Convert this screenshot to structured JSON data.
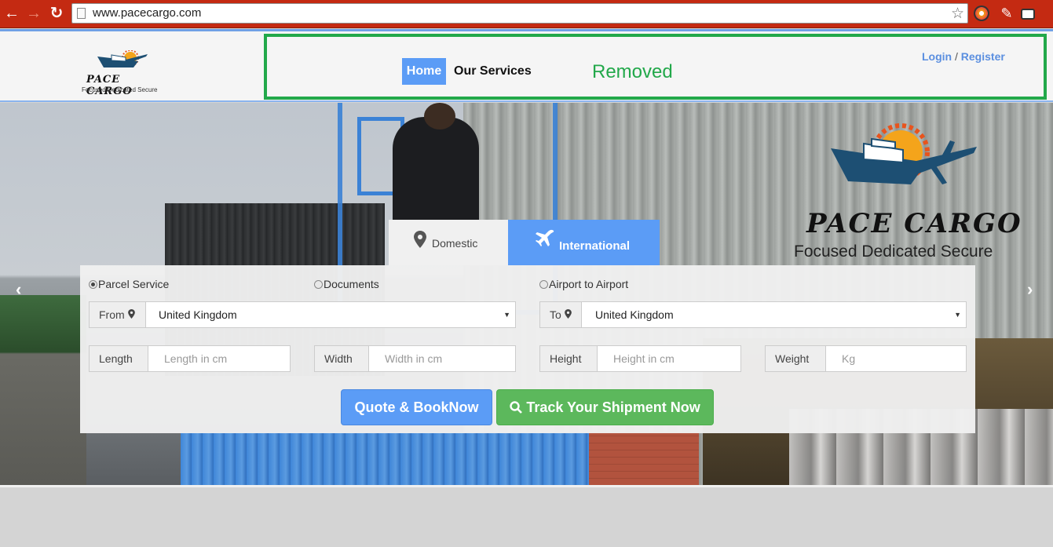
{
  "browser": {
    "url": "www.pacecargo.com",
    "icons": [
      "back-arrow-icon",
      "forward-arrow-icon",
      "reload-icon",
      "bookmark-star-icon"
    ]
  },
  "header": {
    "logo_text": "PACE CARGO",
    "logo_tagline": "Focused Dedicated Secure",
    "nav": {
      "home": "Home",
      "services": "Our Services"
    },
    "removed_label": "Removed",
    "auth": {
      "login": "Login",
      "separator": "/",
      "register": "Register"
    },
    "colors": {
      "accent": "#5b9cf6",
      "removed_box": "#22a84a"
    }
  },
  "hero": {
    "logo_text": "PACE CARGO",
    "logo_tagline": "Focused Dedicated Secure",
    "carousel_prev": "‹",
    "carousel_next": "›"
  },
  "booking": {
    "tabs": {
      "domestic": "Domestic",
      "international": "International"
    },
    "service_types": {
      "parcel": "Parcel Service",
      "documents": "Documents",
      "airport": "Airport to Airport"
    },
    "from": {
      "label": "From",
      "value": "United Kingdom"
    },
    "to": {
      "label": "To",
      "value": "United Kingdom"
    },
    "dimensions": {
      "length": {
        "label": "Length",
        "placeholder": "Length in cm"
      },
      "width": {
        "label": "Width",
        "placeholder": "Width in cm"
      },
      "height": {
        "label": "Height",
        "placeholder": "Height in cm"
      },
      "weight": {
        "label": "Weight",
        "placeholder": "Kg"
      }
    },
    "buttons": {
      "quote": "Quote & BookNow",
      "track": "Track Your Shipment Now"
    },
    "colors": {
      "quote": "#5b9cf6",
      "track": "#5cb85c"
    }
  }
}
